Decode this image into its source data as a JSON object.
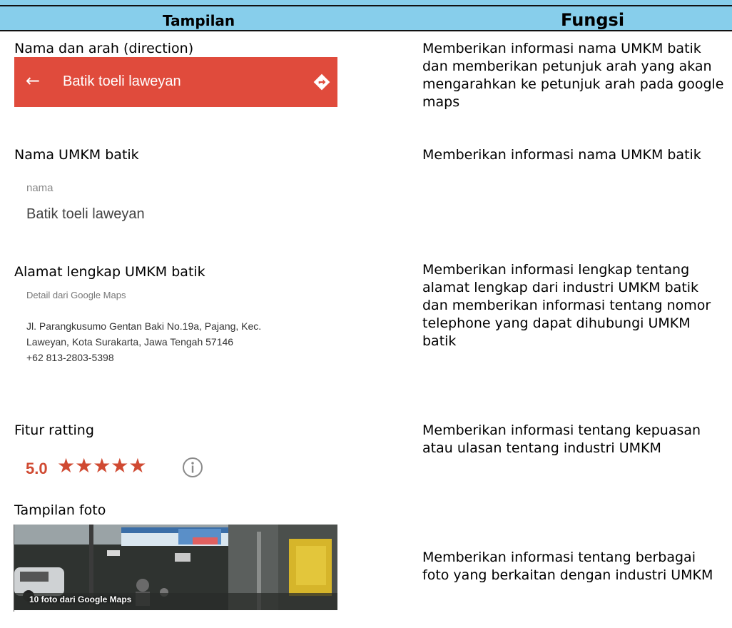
{
  "header": {
    "left": "Tampilan",
    "right": "Fungsi"
  },
  "rows": [
    {
      "label": "Nama dan arah (direction)",
      "desc": "Memberikan informasi nama UMKM batik dan memberikan petunjuk arah yang akan mengarahkan ke petunjuk arah pada google maps"
    },
    {
      "label": "Nama UMKM batik",
      "desc": "Memberikan informasi nama UMKM batik"
    },
    {
      "label": "Alamat lengkap UMKM batik",
      "desc": "Memberikan informasi lengkap tentang alamat lengkap dari industri UMKM batik dan memberikan informasi tentang nomor telephone yang dapat dihubungi UMKM batik"
    },
    {
      "label": "Fitur ratting",
      "desc": "Memberikan informasi tentang kepuasan atau ulasan tentang industri UMKM"
    },
    {
      "label": "Tampilan foto",
      "desc": "Memberikan  informasi tentang berbagai foto yang berkaitan dengan industri UMKM"
    }
  ],
  "appbar": {
    "back_icon": "arrow-left-icon",
    "title": "Batik toeli laweyan",
    "dir_icon": "directions-icon",
    "color": "#e04b3c"
  },
  "name_field": {
    "caption": "nama",
    "value": "Batik toeli laweyan"
  },
  "address": {
    "caption": "Detail dari Google Maps",
    "line1": "Jl. Parangkusumo Gentan Baki No.19a, Pajang, Kec.",
    "line2": "Laweyan, Kota Surakarta, Jawa Tengah 57146",
    "phone": "+62 813-2803-5398"
  },
  "rating": {
    "score": "5.0",
    "stars": "★★★★★",
    "star_count": 5,
    "info_icon": "info-icon",
    "color": "#d04a32"
  },
  "photo": {
    "caption": "10 foto dari Google Maps"
  }
}
